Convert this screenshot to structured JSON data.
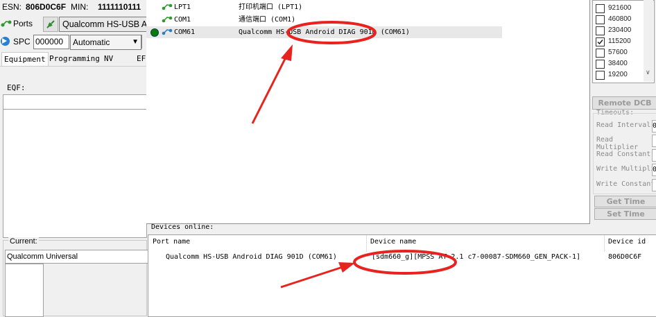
{
  "left": {
    "esn_label": "ESN:",
    "esn_value": "806D0C6F",
    "min_label": "MIN:",
    "min_value": "1111110111",
    "ports_label": "Ports",
    "port_combo": "Qualcomm HS-USB A",
    "spc_label": "SPC",
    "spc_value": "000000",
    "mode_value": "Automatic",
    "tabs": [
      "Equipment",
      "Programming",
      "NV",
      "EF"
    ],
    "eqf_label": "EQF:",
    "current_label": "Current:",
    "current_value": "Qualcomm Universal"
  },
  "ports": [
    {
      "name": "LPT1",
      "desc": "打印机端口 (LPT1)",
      "selected": false
    },
    {
      "name": "COM1",
      "desc": "通信端口 (COM1)",
      "selected": false
    },
    {
      "name": "COM61",
      "desc": "Qualcomm HS-USB Android DIAG 901D (COM61)",
      "selected": true
    }
  ],
  "baud_rates": [
    {
      "value": "921600",
      "checked": false
    },
    {
      "value": "460800",
      "checked": false
    },
    {
      "value": "230400",
      "checked": false
    },
    {
      "value": "115200",
      "checked": true
    },
    {
      "value": "57600",
      "checked": false
    },
    {
      "value": "38400",
      "checked": false
    },
    {
      "value": "19200",
      "checked": false
    }
  ],
  "right": {
    "remote_dcb": "Remote DCB",
    "timeouts_label": "Timeouts:",
    "timeouts": [
      "Read Interval",
      "Read Multiplier",
      "Read Constant",
      "Write Multipli",
      "Write Constant"
    ],
    "timeout_values": [
      "0",
      "",
      "",
      "0",
      ""
    ],
    "get_time": "Get Time",
    "set_time": "Set Time"
  },
  "devices": {
    "label": "Devices online:",
    "headers": [
      "Port name",
      "Device name",
      "Device id"
    ],
    "rows": [
      {
        "port": "Qualcomm HS-USB Android DIAG 901D (COM61)",
        "device": "[sdm660_g][MPSS AT 2.1 c7-00087-SDM660_GEN_PACK-1]",
        "id": "806D0C6F"
      }
    ]
  },
  "colors": {
    "annotation": "#e8231f",
    "selected_row": "#e8e8e8",
    "radio_green": "#0a7a0a"
  }
}
